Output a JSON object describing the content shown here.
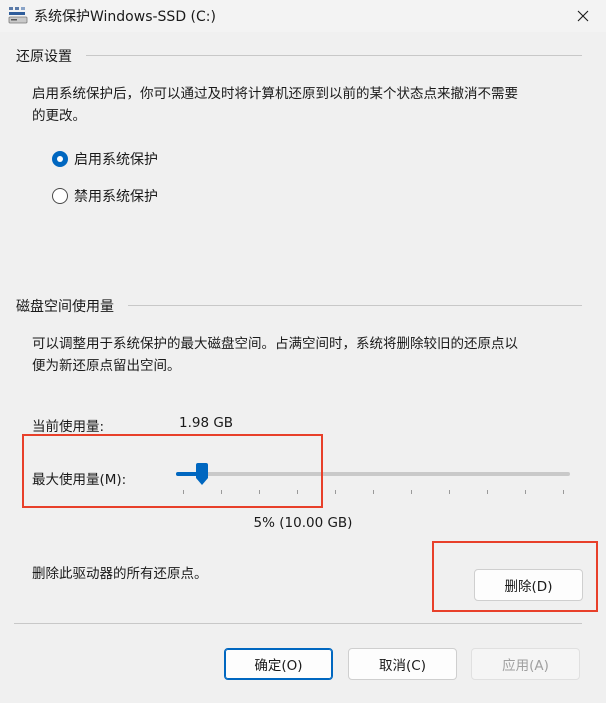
{
  "window": {
    "title": "系统保护Windows-SSD (C:)"
  },
  "restore_settings": {
    "group_title": "还原设置",
    "description_line1": "启用系统保护后，你可以通过及时将计算机还原到以前的某个状态点来撤消不需要",
    "description_line2": "的更改。",
    "options": [
      {
        "label": "启用系统保护",
        "checked": true
      },
      {
        "label": "禁用系统保护",
        "checked": false
      }
    ]
  },
  "disk_usage": {
    "group_title": "磁盘空间使用量",
    "description_line1": "可以调整用于系统保护的最大磁盘空间。占满空间时，系统将删除较旧的还原点以",
    "description_line2": "便为新还原点留出空间。",
    "current_label": "当前使用量:",
    "current_value": "1.98 GB",
    "max_label": "最大使用量(M):",
    "slider_fraction": 0.05,
    "percent_text": "5% (10.00 GB)"
  },
  "delete_section": {
    "text": "删除此驱动器的所有还原点。",
    "button_label": "删除(D)"
  },
  "footer": {
    "ok_label": "确定(O)",
    "cancel_label": "取消(C)",
    "apply_label": "应用(A)"
  },
  "colors": {
    "accent": "#0067c0",
    "highlight": "#e8402a"
  }
}
